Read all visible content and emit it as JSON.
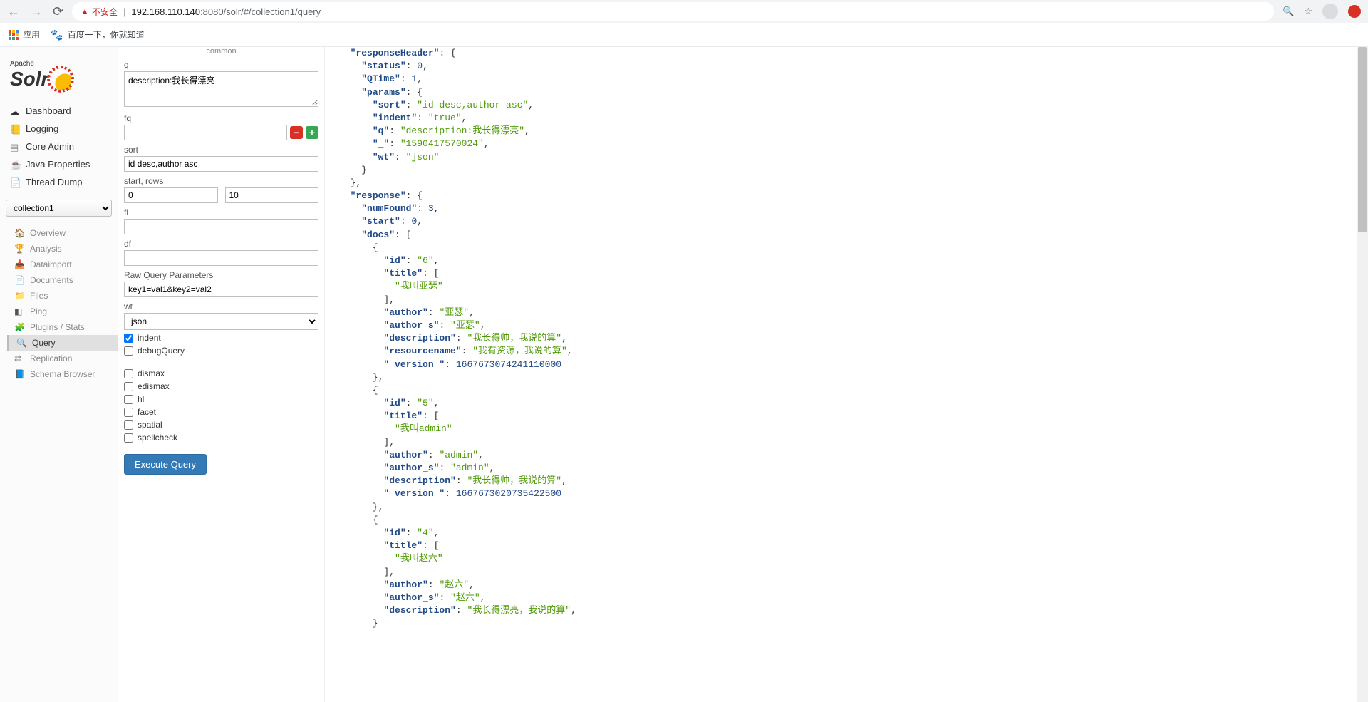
{
  "chrome": {
    "warn_label": "不安全",
    "url_prefix": "192.168.110.140",
    "url_rest": ":8080/solr/#/collection1/query",
    "bookmarks": {
      "apps": "应用",
      "baidu": "百度一下，你就知道"
    }
  },
  "sidebar": {
    "logo_sub": "Apache",
    "logo_main": "Solr",
    "nav": [
      {
        "label": "Dashboard"
      },
      {
        "label": "Logging"
      },
      {
        "label": "Core Admin"
      },
      {
        "label": "Java Properties"
      },
      {
        "label": "Thread Dump"
      }
    ],
    "core_selected": "collection1",
    "subnav": [
      {
        "label": "Overview"
      },
      {
        "label": "Analysis"
      },
      {
        "label": "Dataimport"
      },
      {
        "label": "Documents"
      },
      {
        "label": "Files"
      },
      {
        "label": "Ping"
      },
      {
        "label": "Plugins / Stats"
      },
      {
        "label": "Query",
        "active": true
      },
      {
        "label": "Replication"
      },
      {
        "label": "Schema Browser"
      }
    ]
  },
  "form": {
    "common_label": "common",
    "q_label": "q",
    "q_value": "description:我长得漂亮",
    "fq_label": "fq",
    "fq_value": "",
    "sort_label": "sort",
    "sort_value": "id desc,author asc",
    "startrows_label": "start, rows",
    "start_value": "0",
    "rows_value": "10",
    "fl_label": "fl",
    "fl_value": "",
    "df_label": "df",
    "df_value": "",
    "raw_label": "Raw Query Parameters",
    "raw_value": "key1=val1&key2=val2",
    "wt_label": "wt",
    "wt_value": "json",
    "indent_label": "indent",
    "debug_label": "debugQuery",
    "dismax_label": "dismax",
    "edismax_label": "edismax",
    "hl_label": "hl",
    "facet_label": "facet",
    "spatial_label": "spatial",
    "spellcheck_label": "spellcheck",
    "exec_label": "Execute Query"
  },
  "response": {
    "header": {
      "status": 0,
      "QTime": 1,
      "params": {
        "sort": "id desc,author asc",
        "indent": "true",
        "q": "description:我长得漂亮",
        "_": "1590417570024",
        "wt": "json"
      }
    },
    "body": {
      "numFound": 3,
      "start": 0,
      "docs": [
        {
          "id": "6",
          "title": [
            "我叫亚瑟"
          ],
          "author": "亚瑟",
          "author_s": "亚瑟",
          "description": "我长得帅，我说的算",
          "resourcename": "我有资源，我说的算",
          "_version_": 1667673074241110000
        },
        {
          "id": "5",
          "title": [
            "我叫admin"
          ],
          "author": "admin",
          "author_s": "admin",
          "description": "我长得帅，我说的算",
          "_version_": 1667673020735422500
        },
        {
          "id": "4",
          "title": [
            "我叫赵六"
          ],
          "author": "赵六",
          "author_s": "赵六",
          "description": "我长得漂亮，我说的算"
        }
      ]
    }
  }
}
